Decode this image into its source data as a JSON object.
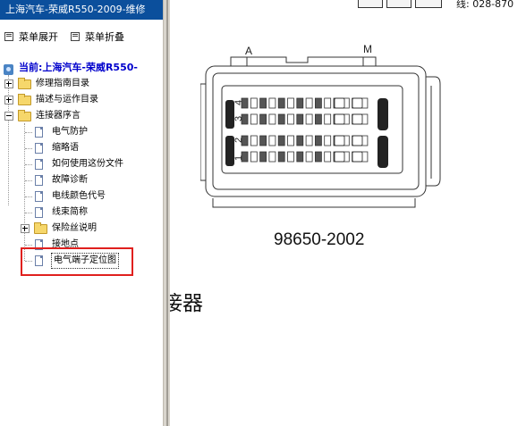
{
  "window": {
    "title": "上海汽车-荣威R550-2009-维修"
  },
  "toolbar": {
    "expand_label": "菜单展开",
    "collapse_label": "菜单折叠"
  },
  "tree": {
    "current_label": "当前:上海汽车-荣威R550-",
    "items": [
      {
        "label": "修理指南目录",
        "kind": "folder",
        "expander": "plus"
      },
      {
        "label": "描述与运作目录",
        "kind": "folder",
        "expander": "plus"
      },
      {
        "label": "连接器序言",
        "kind": "folder",
        "expander": "minus"
      },
      {
        "label": "电气防护",
        "kind": "doc"
      },
      {
        "label": "缩略语",
        "kind": "doc"
      },
      {
        "label": "如何使用这份文件",
        "kind": "doc"
      },
      {
        "label": "故障诊断",
        "kind": "doc"
      },
      {
        "label": "电线颜色代号",
        "kind": "doc"
      },
      {
        "label": "线束简称",
        "kind": "doc"
      },
      {
        "label": "保险丝说明",
        "kind": "folder",
        "expander": "plus"
      },
      {
        "label": "接地点",
        "kind": "doc"
      },
      {
        "label": "电气端子定位图",
        "kind": "doc",
        "selected": true
      }
    ]
  },
  "content": {
    "phone_fragment": "线: 028-870",
    "pin_label_a": "A",
    "pin_label_m": "M",
    "row_numbers": [
      "4",
      "3",
      "2",
      "1"
    ],
    "part_number": "98650-2002",
    "heading_fragment": "接器"
  },
  "colors": {
    "titlebar_bg": "#0b4f9c",
    "highlight_border": "#e0201e",
    "current_text": "#0000cc"
  }
}
